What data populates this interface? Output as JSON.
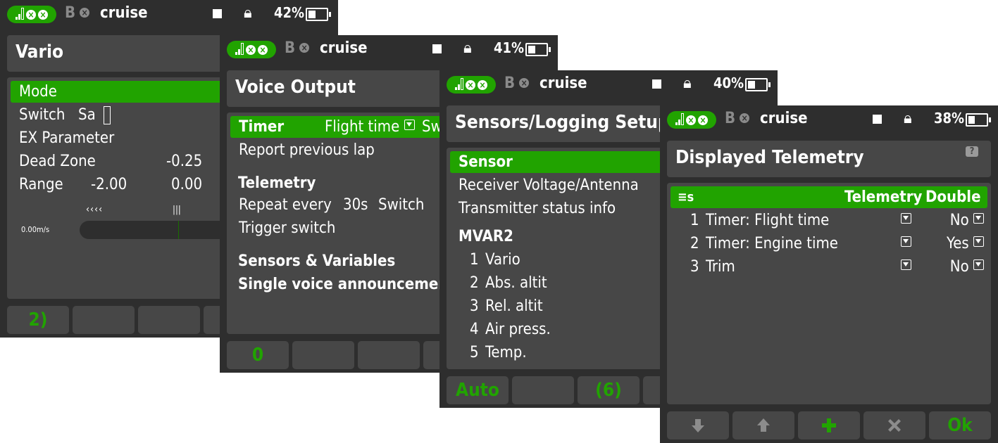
{
  "panels": [
    {
      "status": {
        "rx": "B",
        "model": "cruise",
        "battery": "42%",
        "battery_fill": 0.42
      },
      "title": "Vario",
      "rows": {
        "mode": "Mode",
        "switch": "Switch",
        "switch_val": "Sa",
        "ex_param": "EX Parameter",
        "dead_zone": "Dead Zone",
        "dead_zone_val": "-0.25",
        "range": "Range",
        "range_min": "-2.00",
        "range_max": "0.00"
      },
      "gauge_arrows": "‹‹‹‹",
      "gauge_center": "|||",
      "gauge_value": "0.00m/s",
      "buttons": [
        "2)",
        "",
        "",
        ""
      ]
    },
    {
      "status": {
        "rx": "B",
        "model": "cruise",
        "battery": "41%",
        "battery_fill": 0.41
      },
      "title": "Voice Output",
      "rows": {
        "timer": "Timer",
        "timer_val": "Flight time",
        "timer_val2": "Sw",
        "report_prev": "Report previous lap",
        "telemetry": "Telemetry",
        "repeat": "Repeat every",
        "repeat_val": "30s",
        "repeat_switch": "Switch",
        "trigger": "Trigger switch",
        "sensors_vars": "Sensors & Variables",
        "single_voice": "Single voice announcements"
      },
      "buttons": [
        "0",
        "",
        "",
        ""
      ]
    },
    {
      "status": {
        "rx": "B",
        "model": "cruise",
        "battery": "40%",
        "battery_fill": 0.4
      },
      "title": "Sensors/Logging Setup",
      "rows": {
        "sensor": "Sensor",
        "rx_voltage": "Receiver Voltage/Antenna",
        "tx_status": "Transmitter status info",
        "group": "MVAR2"
      },
      "sensors": [
        {
          "n": "1",
          "name": "Vario"
        },
        {
          "n": "2",
          "name": "Abs. altit"
        },
        {
          "n": "3",
          "name": "Rel. altit"
        },
        {
          "n": "4",
          "name": "Air press."
        },
        {
          "n": "5",
          "name": "Temp."
        }
      ],
      "buttons": [
        "Auto",
        "",
        "(6)",
        ""
      ]
    },
    {
      "status": {
        "rx": "B",
        "model": "cruise",
        "battery": "38%",
        "battery_fill": 0.38
      },
      "title": "Displayed Telemetry",
      "help": "?",
      "header": {
        "icon": "≡s",
        "col1": "Telemetry",
        "col2": "Double"
      },
      "items": [
        {
          "n": "1",
          "name": "Timer: Flight time",
          "double": "No"
        },
        {
          "n": "2",
          "name": "Timer: Engine time",
          "double": "Yes"
        },
        {
          "n": "3",
          "name": "Trim",
          "double": "No"
        }
      ],
      "buttons": [
        "arrow-down-icon",
        "arrow-up-icon",
        "plus-icon",
        "close-icon",
        "Ok"
      ],
      "accent": "#21a300"
    }
  ]
}
